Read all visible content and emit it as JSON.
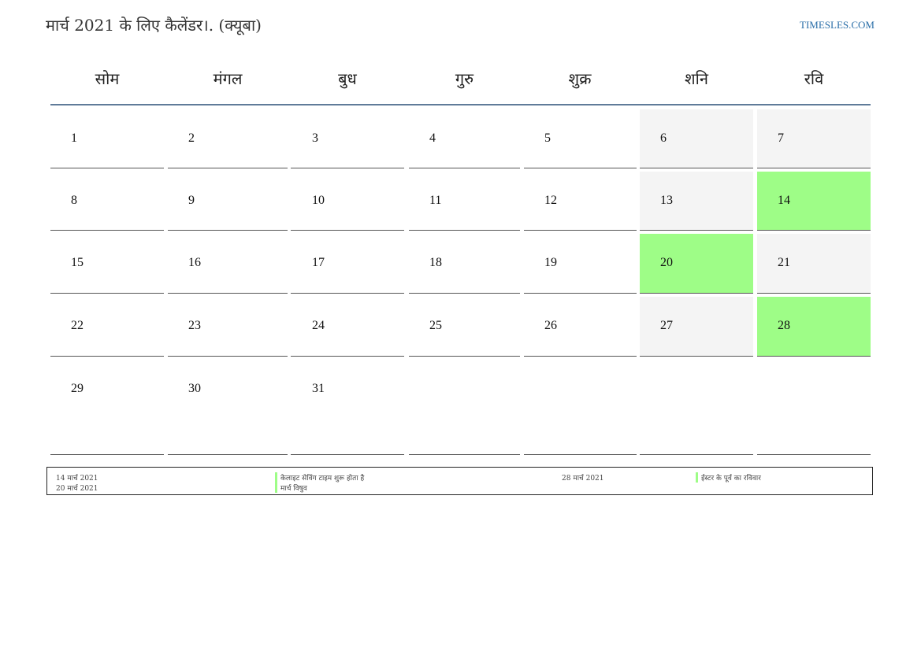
{
  "header": {
    "title": "मार्च 2021 के लिए कैलेंडर।. (क्यूबा)",
    "site": "TIMESLES.COM"
  },
  "weekdays": [
    "सोम",
    "मंगल",
    "बुध",
    "गुरु",
    "शुक्र",
    "शनि",
    "रवि"
  ],
  "weeks": [
    [
      "1",
      "2",
      "3",
      "4",
      "5",
      "6",
      "7"
    ],
    [
      "8",
      "9",
      "10",
      "11",
      "12",
      "13",
      "14"
    ],
    [
      "15",
      "16",
      "17",
      "18",
      "19",
      "20",
      "21"
    ],
    [
      "22",
      "23",
      "24",
      "25",
      "26",
      "27",
      "28"
    ],
    [
      "29",
      "30",
      "31",
      "",
      "",
      "",
      ""
    ]
  ],
  "highlighted_days": [
    "14",
    "20",
    "28"
  ],
  "legend": {
    "entries": [
      {
        "date": "14 मार्च 2021",
        "label": "केलाइट सेविंग टाइम शुरू होता है"
      },
      {
        "date": "20 मार्च 2021",
        "label": "मार्च विषुव"
      },
      {
        "date": "28 मार्च 2021",
        "label": "ईस्टर के पूर्व का रविवार"
      }
    ]
  },
  "colors": {
    "holiday": "#9efd87",
    "weekend": "#f4f4f4",
    "header_rule": "#5f7b99",
    "link": "#2a6ea8"
  }
}
